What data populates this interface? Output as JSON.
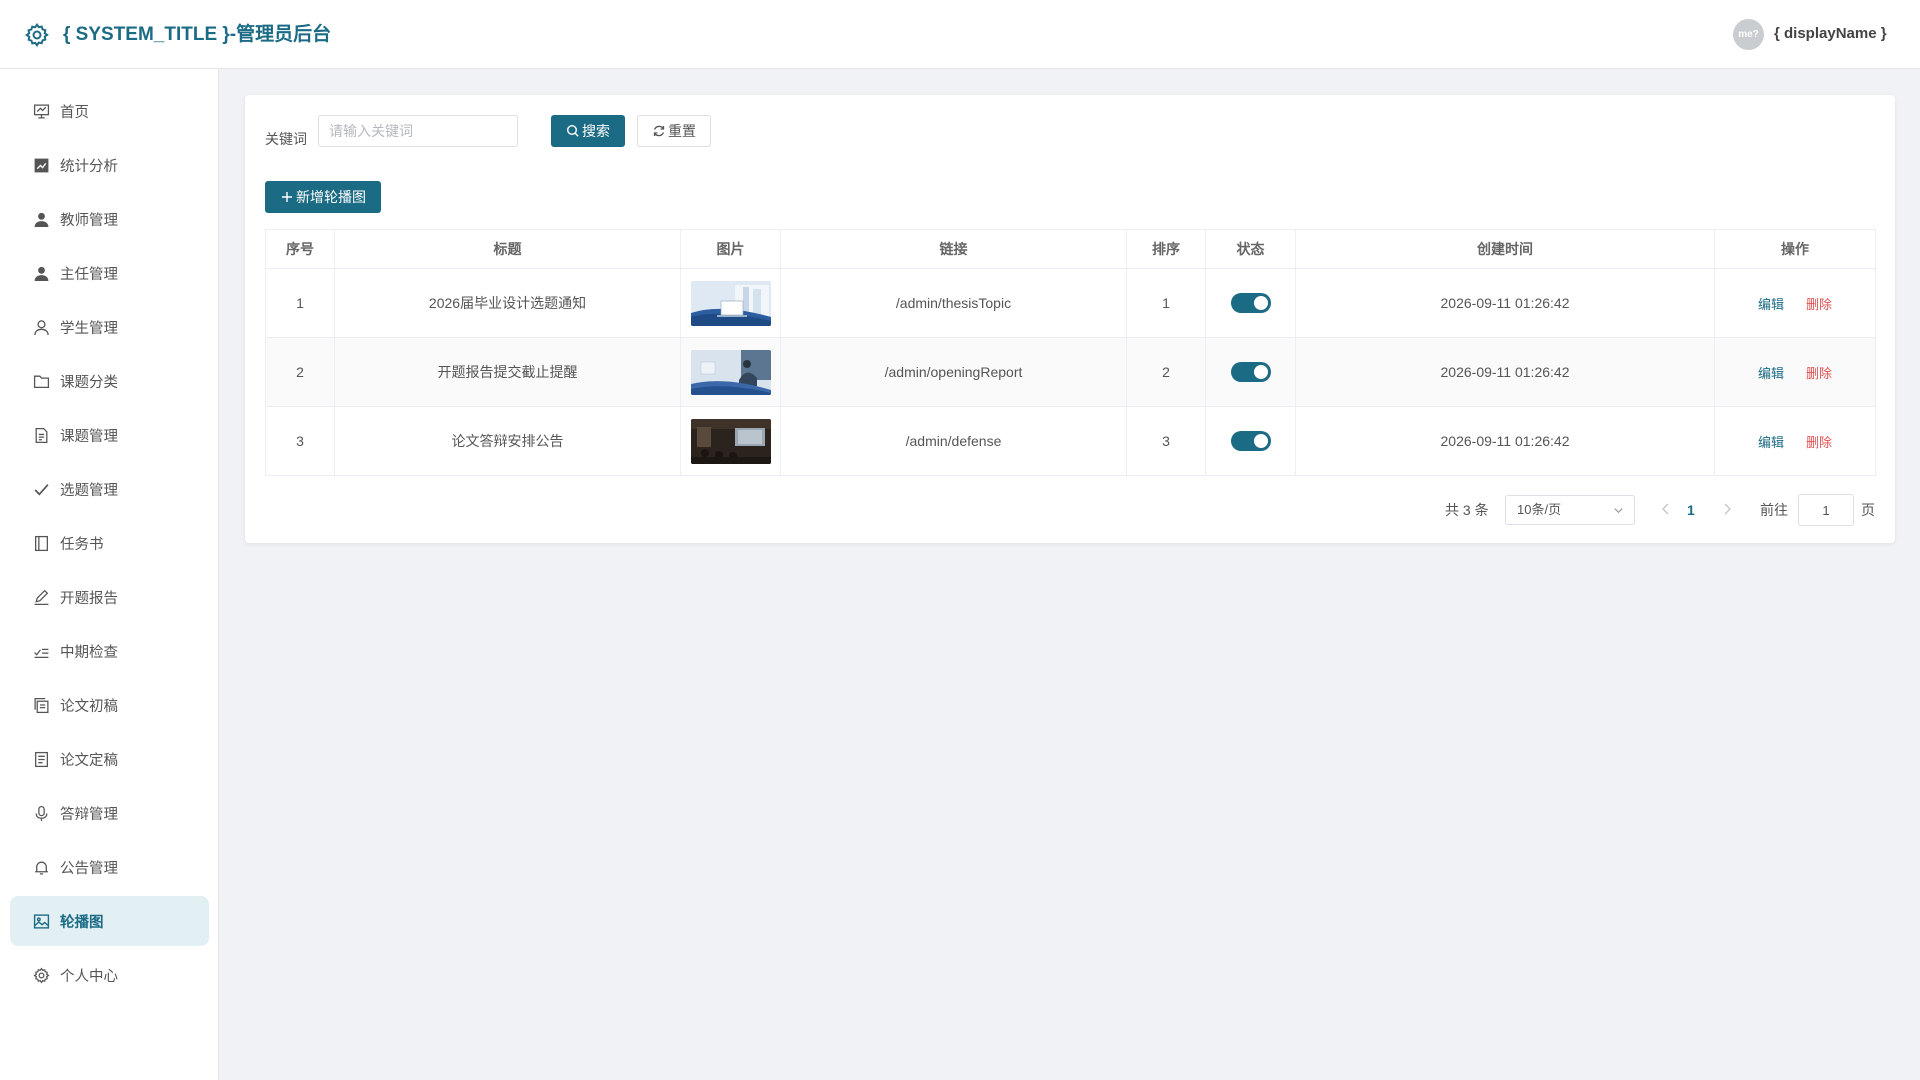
{
  "header": {
    "title": "{ SYSTEM_TITLE }-管理员后台",
    "avatar_text": "me?",
    "display_name": "{ displayName }"
  },
  "sidebar": {
    "items": [
      {
        "label": "首页",
        "icon": "dashboard-icon"
      },
      {
        "label": "统计分析",
        "icon": "chart-icon"
      },
      {
        "label": "教师管理",
        "icon": "user-icon"
      },
      {
        "label": "主任管理",
        "icon": "user-icon"
      },
      {
        "label": "学生管理",
        "icon": "user-outline-icon"
      },
      {
        "label": "课题分类",
        "icon": "folder-icon"
      },
      {
        "label": "课题管理",
        "icon": "document-icon"
      },
      {
        "label": "选题管理",
        "icon": "check-icon"
      },
      {
        "label": "任务书",
        "icon": "notebook-icon"
      },
      {
        "label": "开题报告",
        "icon": "edit-pen-icon"
      },
      {
        "label": "中期检查",
        "icon": "checklist-icon"
      },
      {
        "label": "论文初稿",
        "icon": "copy-document-icon"
      },
      {
        "label": "论文定稿",
        "icon": "tickets-icon"
      },
      {
        "label": "答辩管理",
        "icon": "microphone-icon"
      },
      {
        "label": "公告管理",
        "icon": "bell-icon"
      },
      {
        "label": "轮播图",
        "icon": "picture-icon",
        "active": true
      },
      {
        "label": "个人中心",
        "icon": "setting-icon"
      }
    ]
  },
  "search": {
    "label": "关键词",
    "placeholder": "请输入关键词",
    "search_label": "搜索",
    "reset_label": "重置"
  },
  "toolbar": {
    "add_label": "新增轮播图"
  },
  "table": {
    "columns": [
      "序号",
      "标题",
      "图片",
      "链接",
      "排序",
      "状态",
      "创建时间",
      "操作"
    ],
    "rows": [
      {
        "index": "1",
        "title": "2026届毕业设计选题通知",
        "image": "office-laptop-photo",
        "link": "/admin/thesisTopic",
        "sort": "1",
        "status": true,
        "created": "2026-09-11 01:26:42"
      },
      {
        "index": "2",
        "title": "开题报告提交截止提醒",
        "image": "person-at-desk-photo",
        "link": "/admin/openingReport",
        "sort": "2",
        "status": true,
        "created": "2026-09-11 01:26:42"
      },
      {
        "index": "3",
        "title": "论文答辩安排公告",
        "image": "presentation-room-photo",
        "link": "/admin/defense",
        "sort": "3",
        "status": true,
        "created": "2026-09-11 01:26:42"
      }
    ],
    "edit_label": "编辑",
    "delete_label": "删除"
  },
  "pagination": {
    "total_text": "共 3 条",
    "page_size": "10条/页",
    "current_page": "1",
    "goto_label": "前往",
    "goto_value": "1",
    "page_unit": "页"
  },
  "colors": {
    "primary": "#1b6b85",
    "danger": "#e05252",
    "active_bg": "#e2f0f4"
  }
}
